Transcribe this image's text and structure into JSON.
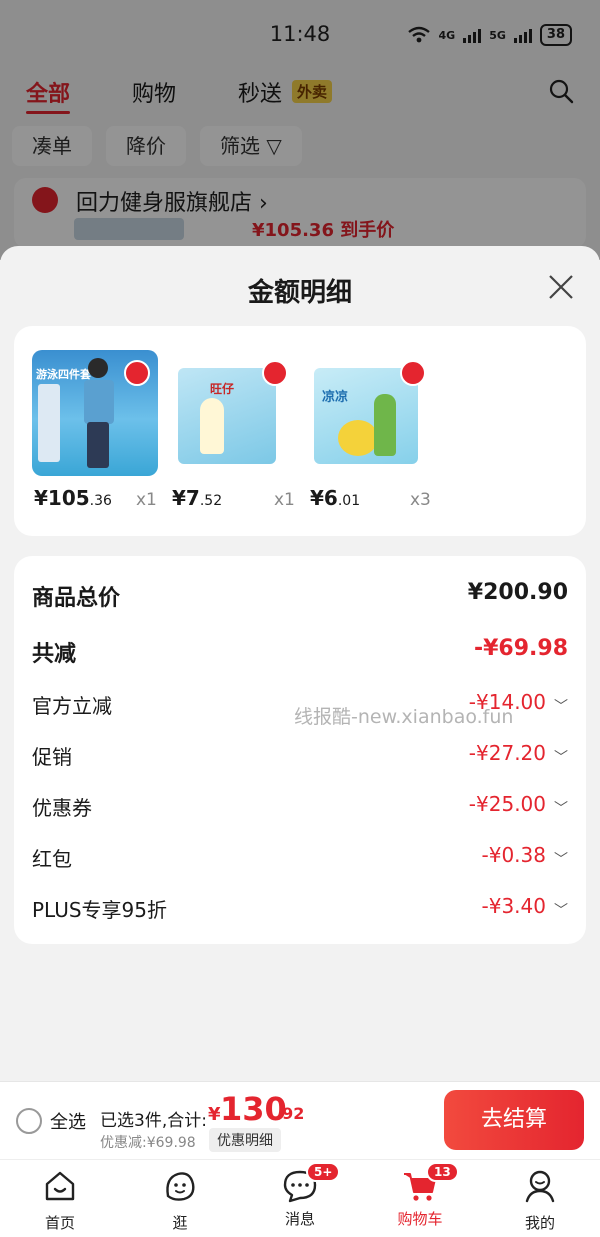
{
  "status": {
    "time": "11:48",
    "net1": "4G",
    "net2": "5G",
    "battery": "38"
  },
  "top_tabs": {
    "all": "全部",
    "shopping": "购物",
    "fast": "秒送",
    "fast_badge": "外卖"
  },
  "filters": [
    "凑单",
    "降价",
    "筛选"
  ],
  "store": {
    "name": "回力健身服旗舰店",
    "price": "¥105.36 到手价"
  },
  "sheet": {
    "title": "金额明细",
    "products": [
      {
        "int": "¥105",
        "dec": ".36",
        "qty": "x1",
        "img_label": "游泳四件套"
      },
      {
        "int": "¥7",
        "dec": ".52",
        "qty": "x1",
        "img_label": "旺仔"
      },
      {
        "int": "¥6",
        "dec": ".01",
        "qty": "x3",
        "img_label": "凉凉"
      }
    ],
    "total": {
      "label": "商品总价",
      "value": "¥200.90"
    },
    "reduce": {
      "label": "共减",
      "value": "-¥69.98"
    },
    "items": [
      {
        "label": "官方立减",
        "value": "-¥14.00"
      },
      {
        "label": "促销",
        "value": "-¥27.20"
      },
      {
        "label": "优惠券",
        "value": "-¥25.00"
      },
      {
        "label": "红包",
        "value": "-¥0.38"
      },
      {
        "label": "PLUS专享95折",
        "value": "-¥3.40"
      }
    ],
    "watermark": "线报酷-new.xianbao.fun"
  },
  "checkout": {
    "select_all": "全选",
    "summary": "已选3件,合计:",
    "yen": "¥",
    "total_int": "130",
    "total_dec": ".92",
    "saved": "优惠减:¥69.98",
    "detail_tag": "优惠明细",
    "pay": "去结算"
  },
  "tabbar": {
    "items": [
      {
        "label": "首页",
        "icon": "home-icon"
      },
      {
        "label": "逛",
        "icon": "face-icon"
      },
      {
        "label": "消息",
        "icon": "message-icon",
        "badge": "5+"
      },
      {
        "label": "购物车",
        "icon": "cart-icon",
        "badge": "13"
      },
      {
        "label": "我的",
        "icon": "person-icon"
      }
    ]
  },
  "colors": {
    "accent": "#e4252f",
    "badge_yellow": "#f6d34a"
  }
}
